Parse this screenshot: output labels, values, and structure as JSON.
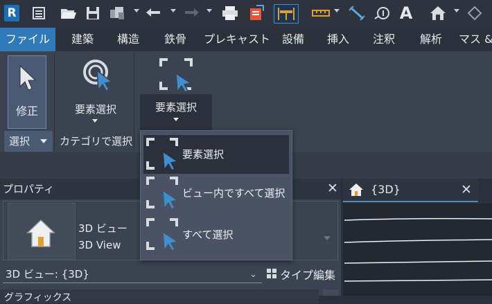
{
  "app": {
    "logo_letter": "R"
  },
  "tabs": [
    "ファイル",
    "建築",
    "構造",
    "鉄骨",
    "プレキャスト",
    "設備",
    "挿入",
    "注釈",
    "解析",
    "マス &"
  ],
  "ribbon": {
    "modify_label": "修正",
    "select_panel_label": "選択",
    "select_by_category_button": "要素選択",
    "category_panel_label": "カテゴリで選択",
    "select_elements_button": "要素選択"
  },
  "dropdown": {
    "items": [
      "要素選択",
      "ビュー内ですべて選択",
      "すべて選択"
    ]
  },
  "properties": {
    "title": "プロパティ",
    "type_name_jp": "3D ビュー",
    "type_name_en": "3D View",
    "instance_selector": "3D ビュー: {3D}",
    "edit_type_button": "タイプ編集",
    "next_section": "グラフィックス"
  },
  "view_tab": {
    "title": "{3D}"
  },
  "colors": {
    "accent": "#2f7ab8",
    "ribbon_bg": "#3b4250",
    "cursor_blue": "#3e8ed0"
  }
}
